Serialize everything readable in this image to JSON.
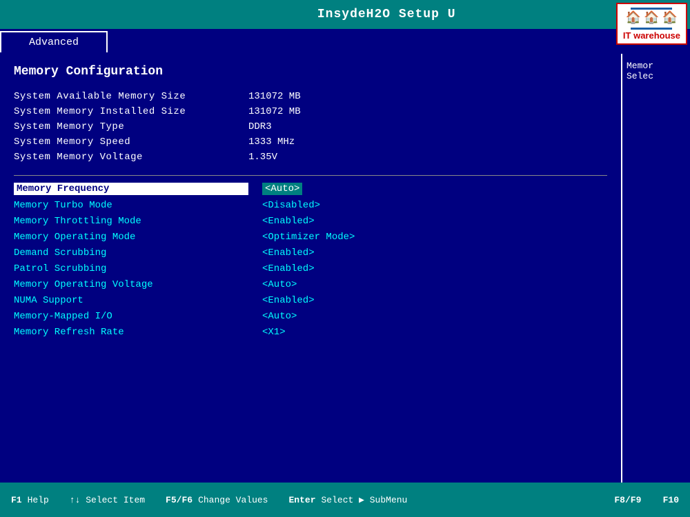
{
  "header": {
    "title": "InsydeH2O Setup U",
    "tab": "Advanced"
  },
  "logo": {
    "text": "IT warehouse",
    "subtext": ""
  },
  "section": {
    "title": "Memory Configuration"
  },
  "info_rows": [
    {
      "label": "System Available Memory Size",
      "value": "131072 MB"
    },
    {
      "label": "System Memory Installed Size",
      "value": "131072 MB"
    },
    {
      "label": "System Memory Type",
      "value": "DDR3"
    },
    {
      "label": "System Memory Speed",
      "value": "1333 MHz"
    },
    {
      "label": "System Memory Voltage",
      "value": "1.35V"
    }
  ],
  "settings_rows": [
    {
      "label": "Memory Frequency",
      "value": "<Auto>",
      "label_style": "highlighted",
      "value_style": "highlighted"
    },
    {
      "label": "Memory Turbo Mode",
      "value": "<Disabled>",
      "label_style": "cyan",
      "value_style": "cyan"
    },
    {
      "label": "Memory Throttling Mode",
      "value": "<Enabled>",
      "label_style": "cyan",
      "value_style": "cyan"
    },
    {
      "label": "Memory Operating Mode",
      "value": "<Optimizer Mode>",
      "label_style": "cyan",
      "value_style": "cyan"
    },
    {
      "label": "Demand Scrubbing",
      "value": "<Enabled>",
      "label_style": "cyan",
      "value_style": "cyan"
    },
    {
      "label": "Patrol Scrubbing",
      "value": "<Enabled>",
      "label_style": "cyan",
      "value_style": "cyan"
    },
    {
      "label": "Memory Operating Voltage",
      "value": "<Auto>",
      "label_style": "cyan",
      "value_style": "cyan"
    },
    {
      "label": "NUMA Support",
      "value": "<Enabled>",
      "label_style": "cyan",
      "value_style": "cyan"
    },
    {
      "label": "Memory-Mapped I/O",
      "value": "<Auto>",
      "label_style": "cyan",
      "value_style": "cyan"
    },
    {
      "label": "Memory Refresh Rate",
      "value": "<X1>",
      "label_style": "cyan",
      "value_style": "cyan"
    }
  ],
  "sidebar": {
    "line1": "Memor",
    "line2": "Selec"
  },
  "bottom": {
    "f1_label": "F1",
    "help_label": "Help",
    "arrows_label": "↑↓ Select Item",
    "f5f6_label": "F5/F6",
    "change_label": "Change Values",
    "enter_label": "Enter",
    "select_label": "Select ▶ SubMenu",
    "f8f9_label": "F8/F9",
    "f10_label": "F10"
  }
}
